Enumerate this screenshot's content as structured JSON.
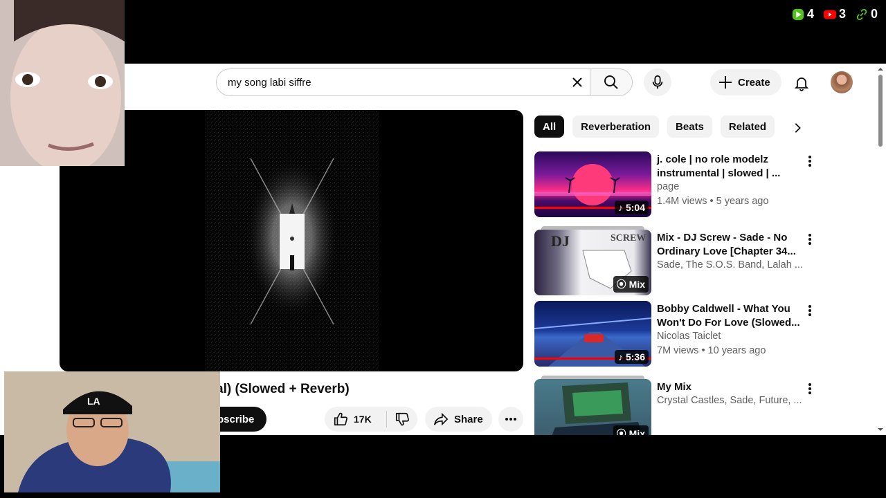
{
  "overlay": {
    "stats": [
      {
        "icon": "play-icon",
        "value": "4",
        "color": "#53c21a"
      },
      {
        "icon": "youtube-icon",
        "value": "3",
        "color": "#ff0000"
      },
      {
        "icon": "link-icon",
        "value": "0",
        "color": "#53c21a"
      }
    ]
  },
  "masthead": {
    "search_query": "my song labi siffre",
    "create_label": "Create"
  },
  "video": {
    "title_visible": "al) (Slowed + Reverb)",
    "subscribe_label": "bscribe",
    "like_count": "17K",
    "share_label": "Share"
  },
  "chips": [
    "All",
    "Reverberation",
    "Beats",
    "Related"
  ],
  "recommendations": [
    {
      "title": "j. cole | no role modelz instrumental | slowed | ...",
      "channel": "page",
      "meta": "1.4M views • 5 years ago",
      "badge": "5:04",
      "badge_icon": "music-note-icon"
    },
    {
      "title": "Mix - DJ Screw - Sade - No Ordinary Love [Chapter 34...",
      "channel": "Sade, The S.O.S. Band, Lalah ...",
      "meta": "",
      "badge": "Mix",
      "badge_icon": "mix-icon"
    },
    {
      "title": "Bobby Caldwell - What You Won't Do For Love (Slowed...",
      "channel": "Nicolas Taiclet",
      "meta": "7M views • 10 years ago",
      "badge": "5:36",
      "badge_icon": "music-note-icon"
    },
    {
      "title": "My Mix",
      "channel": "Crystal Castles, Sade, Future, ...",
      "meta": "",
      "badge": "Mix",
      "badge_icon": "mix-icon"
    }
  ],
  "colors": {
    "accent": "#ff0000",
    "chip_active": "#0f0f0f",
    "chip_bg": "#f2f2f2",
    "meta_text": "#606060"
  }
}
